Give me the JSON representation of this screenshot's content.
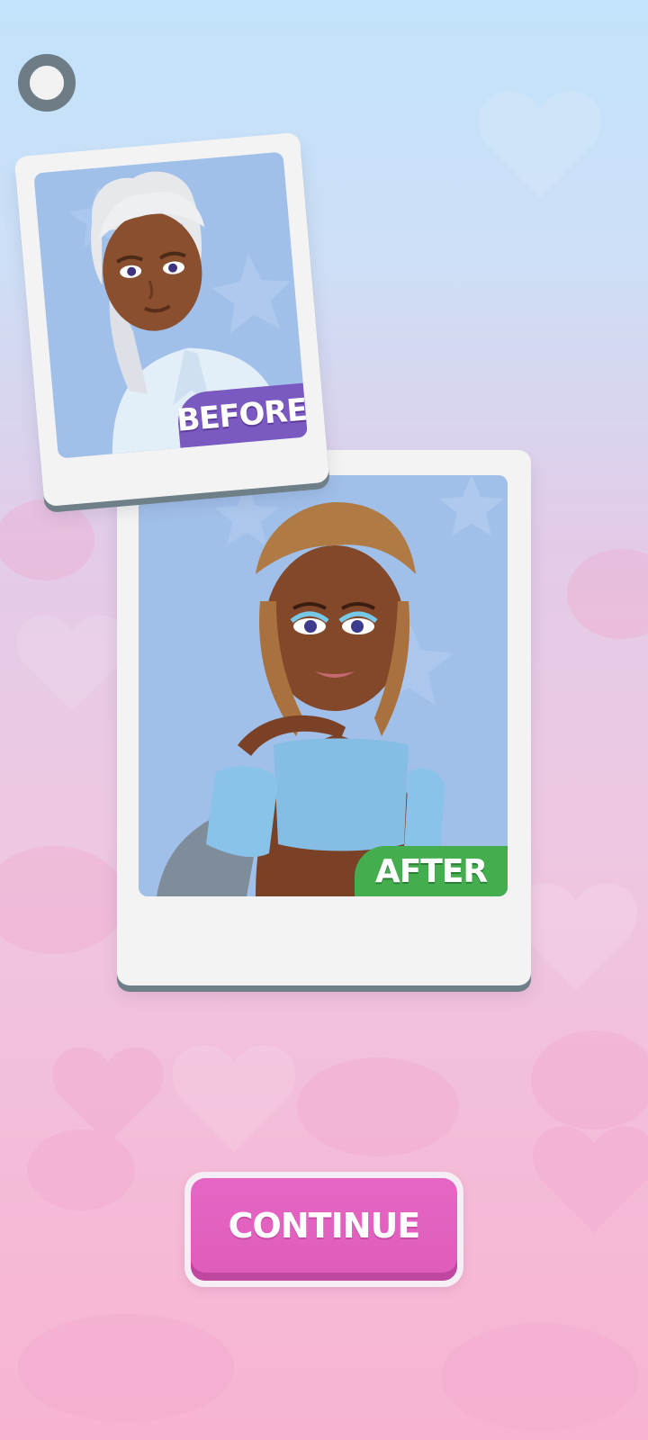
{
  "menu_button": {
    "icon": "circle-menu-icon"
  },
  "before_card": {
    "label": "BEFORE",
    "label_color": "#7a59c0",
    "character": "elderly-woman-white-hair-portrait"
  },
  "after_card": {
    "label": "AFTER",
    "label_color": "#44ae4f",
    "character": "woman-braided-hair-blue-top-portrait"
  },
  "continue_button": {
    "label": "CONTINUE",
    "color": "#e766c5"
  }
}
